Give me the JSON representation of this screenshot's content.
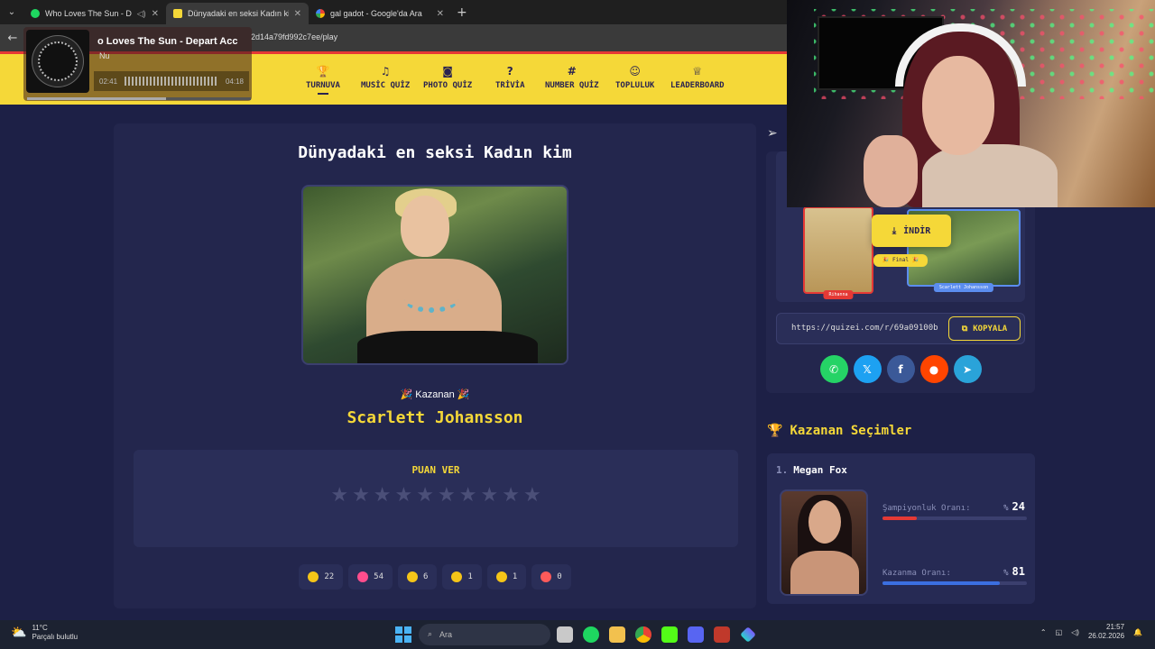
{
  "browser": {
    "tabs": [
      {
        "title": "Who Loves The Sun - Depa",
        "favicon_color": "#1ed760",
        "active": false
      },
      {
        "title": "Dünyadaki en seksi Kadın kim",
        "favicon_color": "#f5d838",
        "active": true
      },
      {
        "title": "gal gadot - Google'da Ara",
        "favicon_color": "#ffffff",
        "active": false
      }
    ],
    "url": "2d14a79fd992c7ee/play"
  },
  "media": {
    "title": "o Loves The Sun - Depart Acc",
    "artist": "Nu",
    "elapsed": "02:41",
    "duration": "04:18",
    "progress": 0.62
  },
  "nav": {
    "items": [
      {
        "label": "TURNUVA",
        "icon": "trophy-icon",
        "glyph": "🏆"
      },
      {
        "label": "MUSİC QUİZ",
        "icon": "music-icon",
        "glyph": "♫"
      },
      {
        "label": "PHOTO QUİZ",
        "icon": "camera-icon",
        "glyph": "◙"
      },
      {
        "label": "TRİVİA",
        "icon": "question-icon",
        "glyph": "?"
      },
      {
        "label": "NUMBER QUİZ",
        "icon": "hash-icon",
        "glyph": "#"
      },
      {
        "label": "TOPLULUK",
        "icon": "users-icon",
        "glyph": "☺"
      },
      {
        "label": "LEADERBOARD",
        "icon": "award-icon",
        "glyph": "♕"
      }
    ]
  },
  "quiz": {
    "title": "Dünyadaki en seksi Kadın kim",
    "winner_label": "Kazanan",
    "winner_name": "Scarlett Johansson",
    "rate_label": "PUAN VER",
    "stars_total": 10,
    "reactions": [
      {
        "icon": "thumbs-up-icon",
        "count": "22",
        "color": "#f5c518"
      },
      {
        "icon": "heart-icon",
        "count": "54",
        "color": "#ff4d8d"
      },
      {
        "icon": "laugh-icon",
        "count": "6",
        "color": "#f5c518"
      },
      {
        "icon": "surprised-icon",
        "count": "1",
        "color": "#f5c518"
      },
      {
        "icon": "sad-icon",
        "count": "1",
        "color": "#f5c518"
      },
      {
        "icon": "angry-icon",
        "count": "0",
        "color": "#ff5a5a"
      }
    ]
  },
  "side": {
    "bracket": {
      "left_name": "Rihanna",
      "right_name": "Scarlett Johansson",
      "final_label": "🎉 Final 🎉",
      "download_label": "İNDİR"
    },
    "share_url": "https://quizei.com/r/69a09100b",
    "copy_label": "KOPYALA",
    "socials": [
      {
        "name": "whatsapp",
        "glyph": "✆",
        "color": "#25d366"
      },
      {
        "name": "x",
        "glyph": "𝕏",
        "color": "#1da1f2"
      },
      {
        "name": "facebook",
        "glyph": "f",
        "color": "#3b5998"
      },
      {
        "name": "reddit",
        "glyph": "●",
        "color": "#ff4500"
      },
      {
        "name": "telegram",
        "glyph": "➤",
        "color": "#2aa3d9"
      }
    ],
    "winners_title": "Kazanan Seçimler",
    "winners": [
      {
        "rank": "1.",
        "name": "Megan Fox",
        "champ_label": "Şampiyonluk Oranı:",
        "champ_value": "24",
        "champ_color": "#e53935",
        "win_label": "Kazanma Oranı:",
        "win_value": "81",
        "win_color": "#3b6fe0",
        "percent_sign": "%"
      }
    ]
  },
  "taskbar": {
    "temp": "11°C",
    "weather": "Parçalı bulutlu",
    "search_placeholder": "Ara",
    "time": "21:57",
    "date": "26.02.2026"
  }
}
